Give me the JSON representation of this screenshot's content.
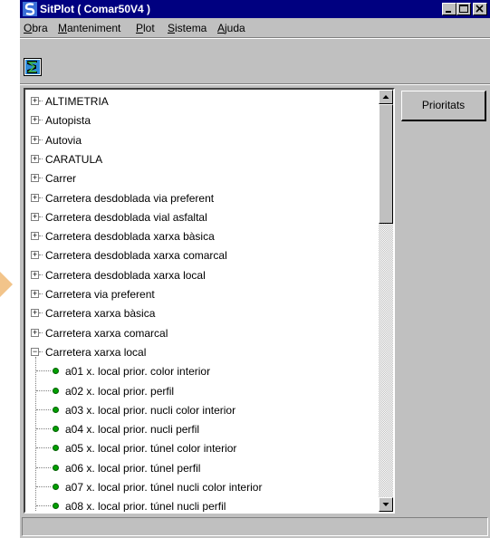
{
  "window": {
    "title": "SitPlot ( Comar50V4 )"
  },
  "menu": [
    {
      "label": "Obra",
      "mnemonic": "O",
      "rest": "bra"
    },
    {
      "label": "Manteniment",
      "mnemonic": "M",
      "rest": "anteniment"
    },
    {
      "label": "Plot",
      "mnemonic": "P",
      "rest": "lot"
    },
    {
      "label": "Sistema",
      "mnemonic": "S",
      "rest": "istema"
    },
    {
      "label": "Ajuda",
      "mnemonic": "A",
      "rest": "juda"
    }
  ],
  "toolbar": {
    "icon": "sitplot-s-icon"
  },
  "tree": {
    "nodes": [
      {
        "label": "ALTIMETRIA",
        "expander": "+"
      },
      {
        "label": "Autopista",
        "expander": "+"
      },
      {
        "label": "Autovia",
        "expander": "+"
      },
      {
        "label": "CARATULA",
        "expander": "+"
      },
      {
        "label": "Carrer",
        "expander": "+"
      },
      {
        "label": "Carretera desdoblada via preferent",
        "expander": "+"
      },
      {
        "label": "Carretera desdoblada vial asfaltal",
        "expander": "+"
      },
      {
        "label": "Carretera desdoblada xarxa bàsica",
        "expander": "+"
      },
      {
        "label": "Carretera desdoblada xarxa comarcal",
        "expander": "+"
      },
      {
        "label": "Carretera desdoblada xarxa local",
        "expander": "+"
      },
      {
        "label": "Carretera via preferent",
        "expander": "+"
      },
      {
        "label": "Carretera xarxa bàsica",
        "expander": "+"
      },
      {
        "label": "Carretera xarxa comarcal",
        "expander": "+"
      },
      {
        "label": "Carretera xarxa local",
        "expander": "−"
      }
    ],
    "children": [
      "a01 x. local prior. color interior",
      "a02 x. local prior. perfil",
      "a03 x. local prior. nucli color interior",
      "a04 x. local prior. nucli perfil",
      "a05 x. local prior. túnel color interior",
      "a06 x. local prior. túnel perfil",
      "a07 x. local prior. túnel nucli color interior",
      "a08 x. local prior. túnel nucli perfil"
    ]
  },
  "buttons": {
    "prioritats": "Prioritats"
  },
  "status": {
    "text": ""
  },
  "colors": {
    "titlebar": "#000080",
    "face": "#c0c0c0",
    "leaf": "#00a000"
  }
}
